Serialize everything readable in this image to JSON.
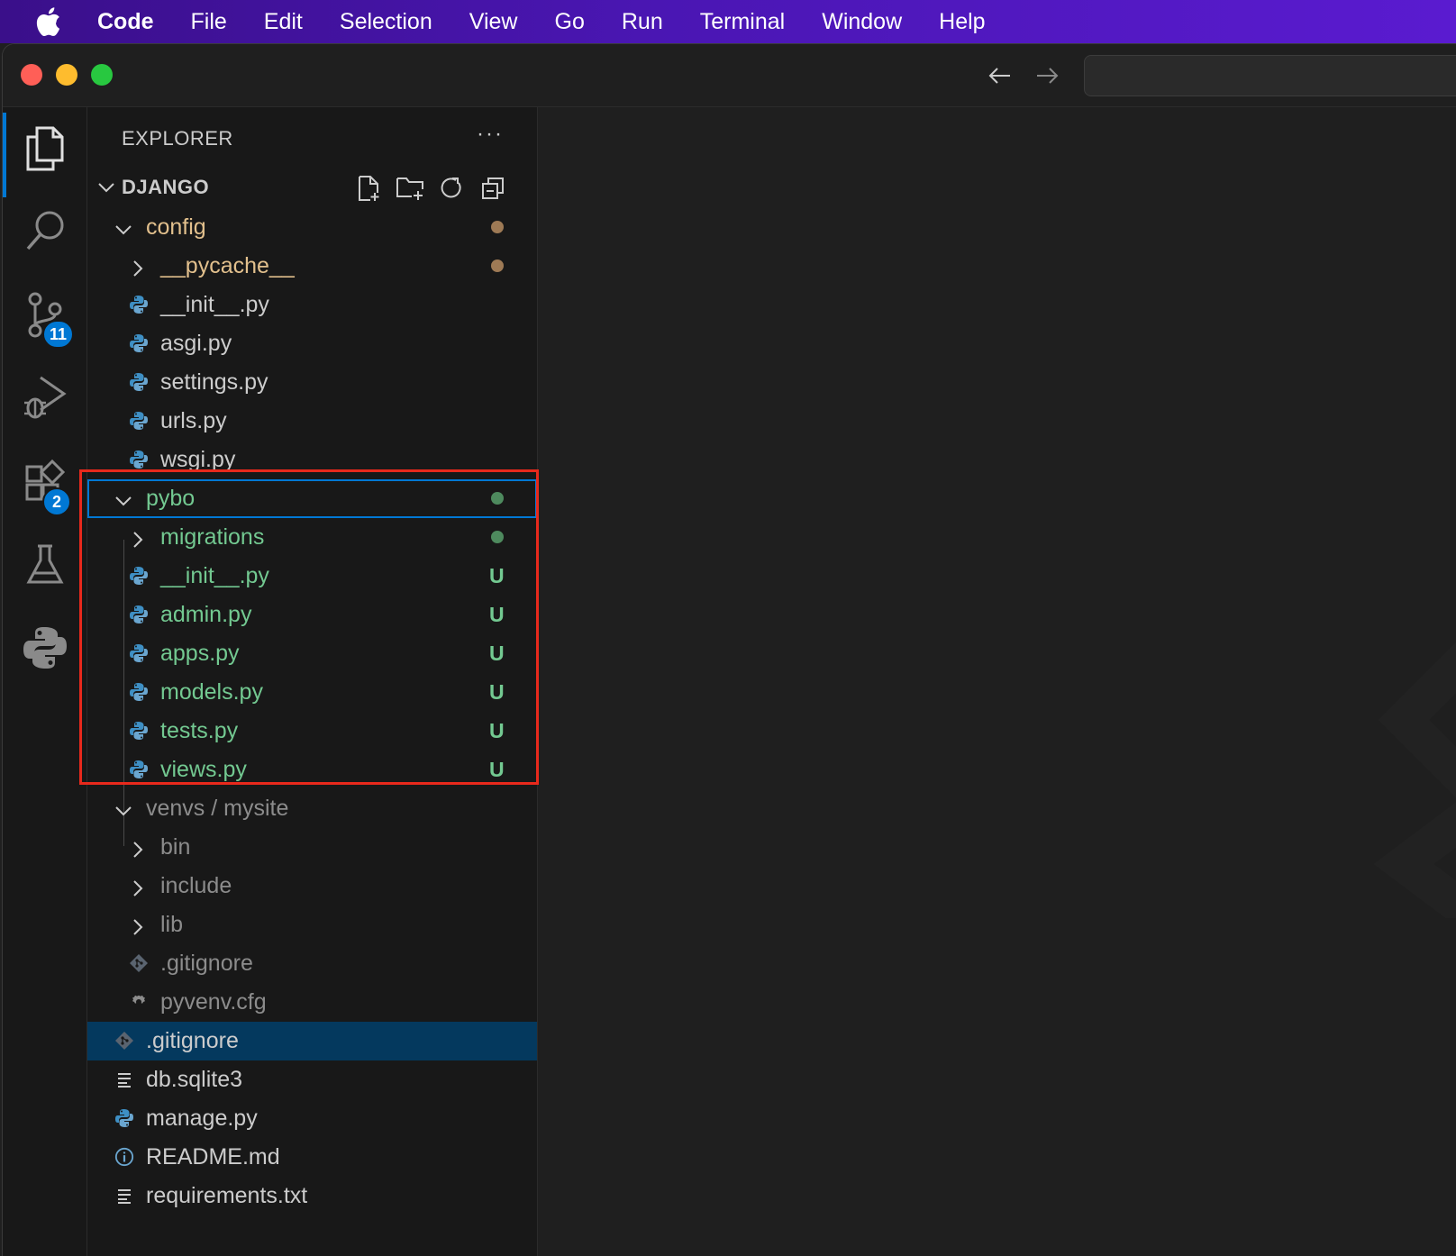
{
  "menubar": {
    "app_name": "Code",
    "items": [
      "File",
      "Edit",
      "Selection",
      "View",
      "Go",
      "Run",
      "Terminal",
      "Window",
      "Help"
    ]
  },
  "activity_bar": {
    "items": [
      {
        "icon": "files-icon",
        "active": true
      },
      {
        "icon": "search-icon"
      },
      {
        "icon": "source-control-icon",
        "badge": "11"
      },
      {
        "icon": "run-debug-icon"
      },
      {
        "icon": "extensions-icon",
        "badge": "2"
      },
      {
        "icon": "testing-icon"
      },
      {
        "icon": "python-icon"
      }
    ]
  },
  "explorer": {
    "header": "EXPLORER",
    "more": "···",
    "section_title": "DJANGO",
    "section_actions": [
      "new-file-icon",
      "new-folder-icon",
      "refresh-icon",
      "collapse-all-icon"
    ],
    "tree": [
      {
        "label": "config",
        "type": "folder",
        "expanded": true,
        "depth": 1,
        "status": "modified",
        "dot": "#9e7a55"
      },
      {
        "label": "__pycache__",
        "type": "folder",
        "expanded": false,
        "depth": 2,
        "status": "modified",
        "dot": "#9e7a55"
      },
      {
        "label": "__init__.py",
        "type": "python",
        "depth": 2,
        "status": "normal"
      },
      {
        "label": "asgi.py",
        "type": "python",
        "depth": 2,
        "status": "normal"
      },
      {
        "label": "settings.py",
        "type": "python",
        "depth": 2,
        "status": "normal"
      },
      {
        "label": "urls.py",
        "type": "python",
        "depth": 2,
        "status": "normal"
      },
      {
        "label": "wsgi.py",
        "type": "python",
        "depth": 2,
        "status": "normal"
      },
      {
        "label": "pybo",
        "type": "folder",
        "expanded": true,
        "depth": 1,
        "status": "untracked",
        "dot": "#4e8a5e",
        "focused": true
      },
      {
        "label": "migrations",
        "type": "folder",
        "expanded": false,
        "depth": 2,
        "status": "untracked",
        "dot": "#4e8a5e"
      },
      {
        "label": "__init__.py",
        "type": "python",
        "depth": 2,
        "status": "untracked",
        "deco": "U"
      },
      {
        "label": "admin.py",
        "type": "python",
        "depth": 2,
        "status": "untracked",
        "deco": "U"
      },
      {
        "label": "apps.py",
        "type": "python",
        "depth": 2,
        "status": "untracked",
        "deco": "U"
      },
      {
        "label": "models.py",
        "type": "python",
        "depth": 2,
        "status": "untracked",
        "deco": "U"
      },
      {
        "label": "tests.py",
        "type": "python",
        "depth": 2,
        "status": "untracked",
        "deco": "U"
      },
      {
        "label": "views.py",
        "type": "python",
        "depth": 2,
        "status": "untracked",
        "deco": "U"
      },
      {
        "label": "venvs / mysite",
        "type": "folder",
        "expanded": true,
        "depth": 1,
        "status": "ignored"
      },
      {
        "label": "bin",
        "type": "folder",
        "expanded": false,
        "depth": 2,
        "status": "ignored"
      },
      {
        "label": "include",
        "type": "folder",
        "expanded": false,
        "depth": 2,
        "status": "ignored"
      },
      {
        "label": "lib",
        "type": "folder",
        "expanded": false,
        "depth": 2,
        "status": "ignored"
      },
      {
        "label": ".gitignore",
        "type": "git",
        "depth": 2,
        "status": "ignored"
      },
      {
        "label": "pyvenv.cfg",
        "type": "gear",
        "depth": 2,
        "status": "ignored"
      },
      {
        "label": ".gitignore",
        "type": "git",
        "depth": 1,
        "status": "normal",
        "selected": true
      },
      {
        "label": "db.sqlite3",
        "type": "text",
        "depth": 1,
        "status": "normal"
      },
      {
        "label": "manage.py",
        "type": "python",
        "depth": 1,
        "status": "normal"
      },
      {
        "label": "README.md",
        "type": "info",
        "depth": 1,
        "status": "normal"
      },
      {
        "label": "requirements.txt",
        "type": "text",
        "depth": 1,
        "status": "normal"
      }
    ]
  },
  "colors": {
    "accent": "#0078d4",
    "untracked": "#73c991",
    "modified": "#e2c08d",
    "ignored": "#8c8c8c",
    "highlight_box": "#e8291c"
  }
}
